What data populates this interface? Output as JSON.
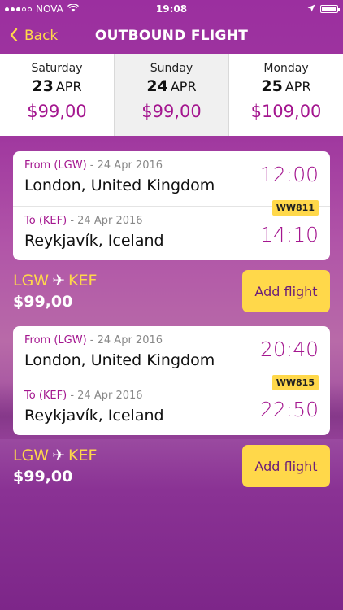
{
  "status_bar": {
    "carrier": "NOVA",
    "time": "19:08"
  },
  "nav": {
    "back_label": "Back",
    "title": "OUTBOUND FLIGHT"
  },
  "date_tabs": [
    {
      "day_of_week": "Saturday",
      "day": "23",
      "month": "APR",
      "price": "$99,00",
      "selected": false
    },
    {
      "day_of_week": "Sunday",
      "day": "24",
      "month": "APR",
      "price": "$99,00",
      "selected": true
    },
    {
      "day_of_week": "Monday",
      "day": "25",
      "month": "APR",
      "price": "$109,00",
      "selected": false
    }
  ],
  "flights": [
    {
      "departure": {
        "label": "From (LGW)",
        "date": "- 24 Apr 2016",
        "city": "London, United Kingdom",
        "time": "12:00"
      },
      "flight_number": "WW811",
      "arrival": {
        "label": "To (KEF)",
        "date": "- 24 Apr 2016",
        "city": "Reykjavík, Iceland",
        "time": "14:10"
      },
      "route_from": "LGW",
      "route_to": "KEF",
      "price": "$99,00",
      "add_label": "Add flight"
    },
    {
      "departure": {
        "label": "From (LGW)",
        "date": "- 24 Apr 2016",
        "city": "London, United Kingdom",
        "time": "20:40"
      },
      "flight_number": "WW815",
      "arrival": {
        "label": "To (KEF)",
        "date": "- 24 Apr 2016",
        "city": "Reykjavík, Iceland",
        "time": "22:50"
      },
      "route_from": "LGW",
      "route_to": "KEF",
      "price": "$99,00",
      "add_label": "Add flight"
    }
  ],
  "colors": {
    "brand_purple": "#a4168f",
    "accent_yellow": "#ffd84a"
  }
}
